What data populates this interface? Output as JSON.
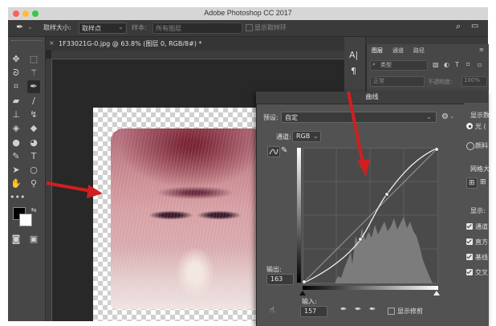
{
  "window": {
    "title": "Adobe Photoshop CC 2017"
  },
  "options_bar": {
    "sample_size_label": "取样大小:",
    "sample_size_value": "取样点",
    "sample_label": "样本:",
    "sample_value": "所有图层",
    "show_ring_label": "显示取样环"
  },
  "document_tab": {
    "label": "1F33021G-0.jpg @ 63.8% (图层 0, RGB/8#) *",
    "close": "×"
  },
  "layers_panel": {
    "tabs": [
      "图层",
      "通道",
      "路径"
    ],
    "kind_label": "类型",
    "blend_mode": "正常",
    "opacity_label": "不透明度:",
    "opacity_value": "100%"
  },
  "curves_dialog": {
    "title": "曲线",
    "preset_label": "预设:",
    "preset_value": "自定",
    "channel_label": "通道:",
    "channel_value": "RGB",
    "output_label": "输出:",
    "output_value": "163",
    "input_label": "输入:",
    "input_value": "157",
    "show_clipping_label": "显示修剪",
    "side": {
      "display_header": "显示数",
      "light_option": "光 (",
      "pigment_option": "颜料",
      "grid_header": "网格大",
      "show_header": "显示:",
      "show_items": [
        "通道",
        "直方",
        "基线",
        "交叉"
      ]
    }
  },
  "colors": {
    "arrow": "#d01f1f",
    "dialog_bg": "#525252",
    "workspace_bg": "#282828"
  },
  "icons": {
    "tools": [
      "move-icon",
      "marquee-icon",
      "lasso-icon",
      "magic-wand-icon",
      "crop-icon",
      "eyedropper-icon",
      "healing-icon",
      "brush-icon",
      "stamp-icon",
      "history-brush-icon",
      "eraser-icon",
      "bucket-icon",
      "blur-icon",
      "dodge-icon",
      "pen-icon",
      "type-icon",
      "path-select-icon",
      "shape-icon",
      "hand-icon",
      "zoom-icon"
    ]
  }
}
